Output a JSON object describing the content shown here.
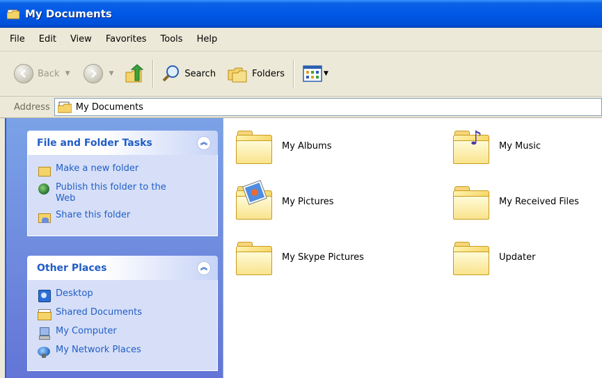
{
  "window": {
    "title": "My Documents"
  },
  "menu": {
    "items": [
      "File",
      "Edit",
      "View",
      "Favorites",
      "Tools",
      "Help"
    ]
  },
  "toolbar": {
    "back_label": "Back",
    "search_label": "Search",
    "folders_label": "Folders"
  },
  "address": {
    "label": "Address",
    "value": "My Documents"
  },
  "tasks": {
    "file_folder": {
      "title": "File and Folder Tasks",
      "collapse_glyph": "︽",
      "items": [
        {
          "label": "Make a new folder",
          "icon": "new-folder-icon"
        },
        {
          "label": "Publish this folder to the Web",
          "icon": "publish-web-icon"
        },
        {
          "label": "Share this folder",
          "icon": "share-folder-icon"
        }
      ]
    },
    "other_places": {
      "title": "Other Places",
      "collapse_glyph": "︽",
      "items": [
        {
          "label": "Desktop",
          "icon": "desktop-icon"
        },
        {
          "label": "Shared Documents",
          "icon": "shared-documents-icon"
        },
        {
          "label": "My Computer",
          "icon": "my-computer-icon"
        },
        {
          "label": "My Network Places",
          "icon": "network-places-icon"
        }
      ]
    }
  },
  "files": [
    {
      "label": "My Albums",
      "icon": "folder-icon"
    },
    {
      "label": "My Music",
      "icon": "music-folder-icon"
    },
    {
      "label": "My Pictures",
      "icon": "pictures-folder-icon"
    },
    {
      "label": "My Received Files",
      "icon": "folder-icon"
    },
    {
      "label": "My Skype Pictures",
      "icon": "folder-icon"
    },
    {
      "label": "Updater",
      "icon": "folder-icon"
    }
  ]
}
